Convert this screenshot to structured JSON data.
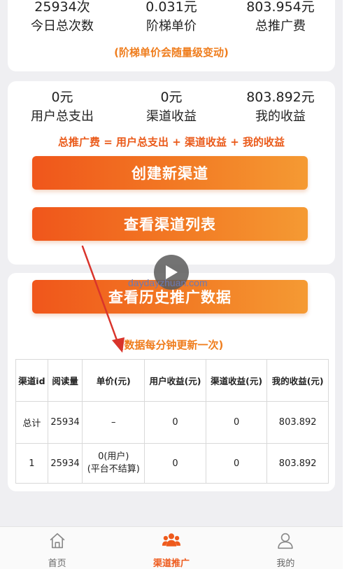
{
  "summary": {
    "stats": [
      {
        "value": "25934次",
        "label": "今日总次数"
      },
      {
        "value": "0.031元",
        "label": "阶梯单价"
      },
      {
        "value": "803.954元",
        "label": "总推广费"
      }
    ],
    "note": "(阶梯单价会随量级变动)"
  },
  "income": {
    "stats": [
      {
        "value": "0元",
        "label": "用户总支出"
      },
      {
        "value": "0元",
        "label": "渠道收益"
      },
      {
        "value": "803.892元",
        "label": "我的收益"
      }
    ],
    "formula": "总推广费 = 用户总支出 + 渠道收益 + 我的收益",
    "create_label": "创建新渠道",
    "list_label": "查看渠道列表"
  },
  "history": {
    "button_label": "查看历史推广数据",
    "note": "(数据每分钟更新一次)"
  },
  "watermark": "daydayzhuan.com",
  "table": {
    "headers": [
      "渠道id",
      "阅读量",
      "单价(元)",
      "用户收益(元)",
      "渠道收益(元)",
      "我的收益(元)"
    ],
    "rows": [
      {
        "id": "总计",
        "reads": "25934",
        "price": "–",
        "price_sub": "",
        "user": "0",
        "channel": "0",
        "mine": "803.892"
      },
      {
        "id": "1",
        "reads": "25934",
        "price": "0(用户)",
        "price_sub": "(平台不结算)",
        "user": "0",
        "channel": "0",
        "mine": "803.892"
      }
    ]
  },
  "tabbar": {
    "items": [
      {
        "label": "首页",
        "icon": "home-icon"
      },
      {
        "label": "渠道推广",
        "icon": "group-icon"
      },
      {
        "label": "我的",
        "icon": "user-icon"
      }
    ],
    "active_index": 1,
    "active_color": "#ee5a1c"
  },
  "colors": {
    "accent": "#ef7d1d",
    "button_gradient": [
      "#f0561b",
      "#f59a33"
    ]
  }
}
